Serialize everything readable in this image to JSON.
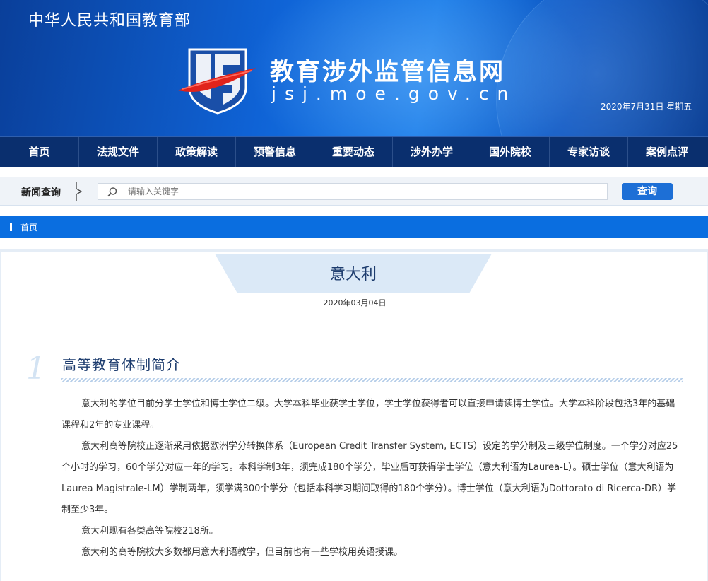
{
  "header": {
    "ministry": "中华人民共和国教育部",
    "site_name": "教育涉外监管信息网",
    "domain": "jsj.moe.gov.cn",
    "date": "2020年7月31日  星期五"
  },
  "nav": {
    "items": [
      "首页",
      "法规文件",
      "政策解读",
      "预警信息",
      "重要动态",
      "涉外办学",
      "国外院校",
      "专家访谈",
      "案例点评"
    ]
  },
  "search": {
    "label": "新闻查询",
    "placeholder": "请输入关键字",
    "button": "查询"
  },
  "breadcrumb": {
    "home": "首页"
  },
  "article": {
    "title": "意大利",
    "date": "2020年03月04日",
    "section_number": "1",
    "section_title": "高等教育体制简介",
    "paragraphs": [
      "意大利的学位目前分学士学位和博士学位二级。大学本科毕业获学士学位，学士学位获得者可以直接申请读博士学位。大学本科阶段包括3年的基础课程和2年的专业课程。",
      "意大利高等院校正逐渐采用依据欧洲学分转换体系（European Credit Transfer System, ECTS）设定的学分制及三级学位制度。一个学分对应25个小时的学习，60个学分对应一年的学习。本科学制3年，须完成180个学分，毕业后可获得学士学位（意大利语为Laurea-L）。硕士学位（意大利语为Laurea Magistrale-LM）学制两年，须学满300个学分（包括本科学习期间取得的180个学分）。博士学位（意大利语为Dottorato di Ricerca-DR）学制至少3年。",
      "意大利现有各类高等院校218所。",
      "意大利的高等院校大多数都用意大利语教学，但目前也有一些学校用英语授课。"
    ]
  },
  "colors": {
    "header_blue": "#0f63d6",
    "nav_navy": "#0a2f6e",
    "breadcrumb_blue": "#0a6ee0",
    "title_text": "#1d3c6e"
  }
}
